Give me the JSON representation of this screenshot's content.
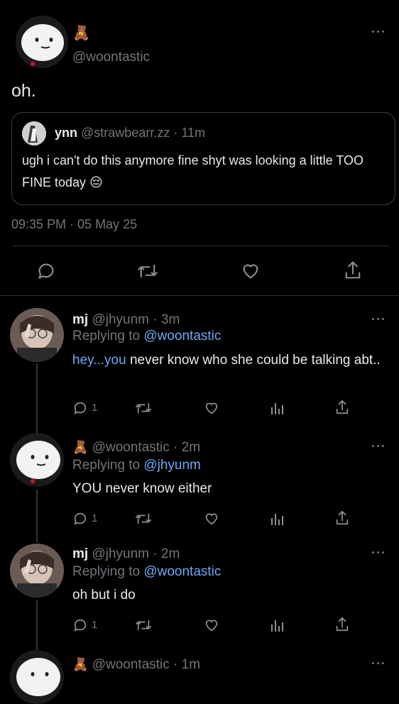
{
  "main_tweet": {
    "author_emoji": "🧸",
    "handle": "@woontastic",
    "text": "oh.",
    "quote": {
      "name": "ynn",
      "handle": "@strawbearr.zz",
      "dot": "·",
      "time": "11m",
      "text": "ugh i can't do this anymore fine shyt was looking a little TOO FINE today 😔"
    },
    "timestamp": "09:35 PM · 05 May 25"
  },
  "replies": [
    {
      "name": "mj",
      "name_emoji": "",
      "handle": "@jhyunm",
      "time": "· 3m",
      "replying_label": "Replying to",
      "replying_to": "@woontastic",
      "text_link": "hey...you",
      "text": " never know who she could be talking abt..",
      "reply_count": "1"
    },
    {
      "name": "",
      "name_emoji": "🧸",
      "handle": "@woontastic",
      "time": "· 2m",
      "replying_label": "Replying to",
      "replying_to": "@jhyunm",
      "text_link": "",
      "text": "YOU never know either",
      "reply_count": "1"
    },
    {
      "name": "mj",
      "name_emoji": "",
      "handle": "@jhyunm",
      "time": "· 2m",
      "replying_label": "Replying to",
      "replying_to": "@woontastic",
      "text_link": "",
      "text": "oh but i do",
      "reply_count": "1"
    },
    {
      "name": "",
      "name_emoji": "🧸",
      "handle": "@woontastic",
      "time": "· 1m"
    }
  ],
  "colors": {
    "background": "#000000",
    "text": "#e7e9ea",
    "muted": "#71767b",
    "link": "#6ea8f5",
    "border": "#2f3336"
  },
  "icons": [
    "reply-icon",
    "retweet-icon",
    "like-icon",
    "share-icon",
    "views-icon",
    "more-icon"
  ]
}
